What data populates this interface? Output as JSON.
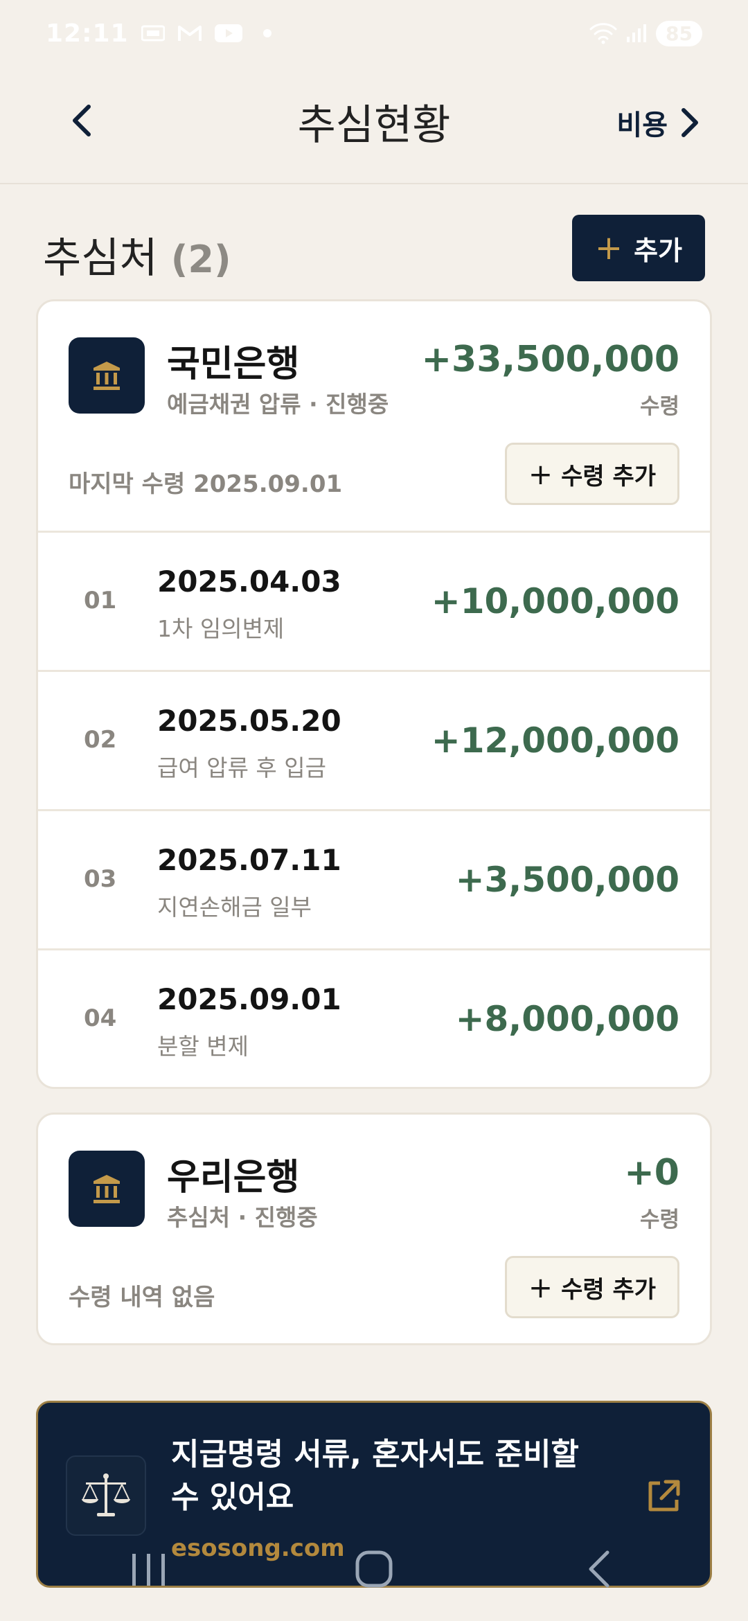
{
  "status_bar": {
    "time": "12:11",
    "battery": "85"
  },
  "header": {
    "title": "추심현황",
    "cost_label": "비용"
  },
  "section": {
    "title": "추심처",
    "count": "(2)",
    "add_label": "추가"
  },
  "creditors": [
    {
      "name": "국민은행",
      "subtitle": "예금채권 압류 · 진행중",
      "total": "+33,500,000",
      "total_label": "수령",
      "last_received": "마지막 수령 2025.09.01",
      "receive_button": "수령 추가",
      "entries": [
        {
          "no": "01",
          "date": "2025.04.03",
          "desc": "1차 임의변제",
          "amount": "+10,000,000"
        },
        {
          "no": "02",
          "date": "2025.05.20",
          "desc": "급여 압류 후 입금",
          "amount": "+12,000,000"
        },
        {
          "no": "03",
          "date": "2025.07.11",
          "desc": "지연손해금 일부",
          "amount": "+3,500,000"
        },
        {
          "no": "04",
          "date": "2025.09.01",
          "desc": "분할 변제",
          "amount": "+8,000,000"
        }
      ]
    },
    {
      "name": "우리은행",
      "subtitle": "추심처 · 진행중",
      "total": "+0",
      "total_label": "수령",
      "last_received": "수령 내역 없음",
      "receive_button": "수령 추가",
      "entries": []
    }
  ],
  "banner": {
    "text": "지급명령 서류, 혼자서도 준비할 수 있어요",
    "link": "esosong.com"
  },
  "colors": {
    "navy": "#0f2038",
    "gold": "#b3893d",
    "positive_green": "#3d6a4e",
    "background": "#f4f0ea"
  },
  "icons": {
    "bank": "bank-icon",
    "scales": "scales-icon",
    "external": "external-link-icon"
  }
}
